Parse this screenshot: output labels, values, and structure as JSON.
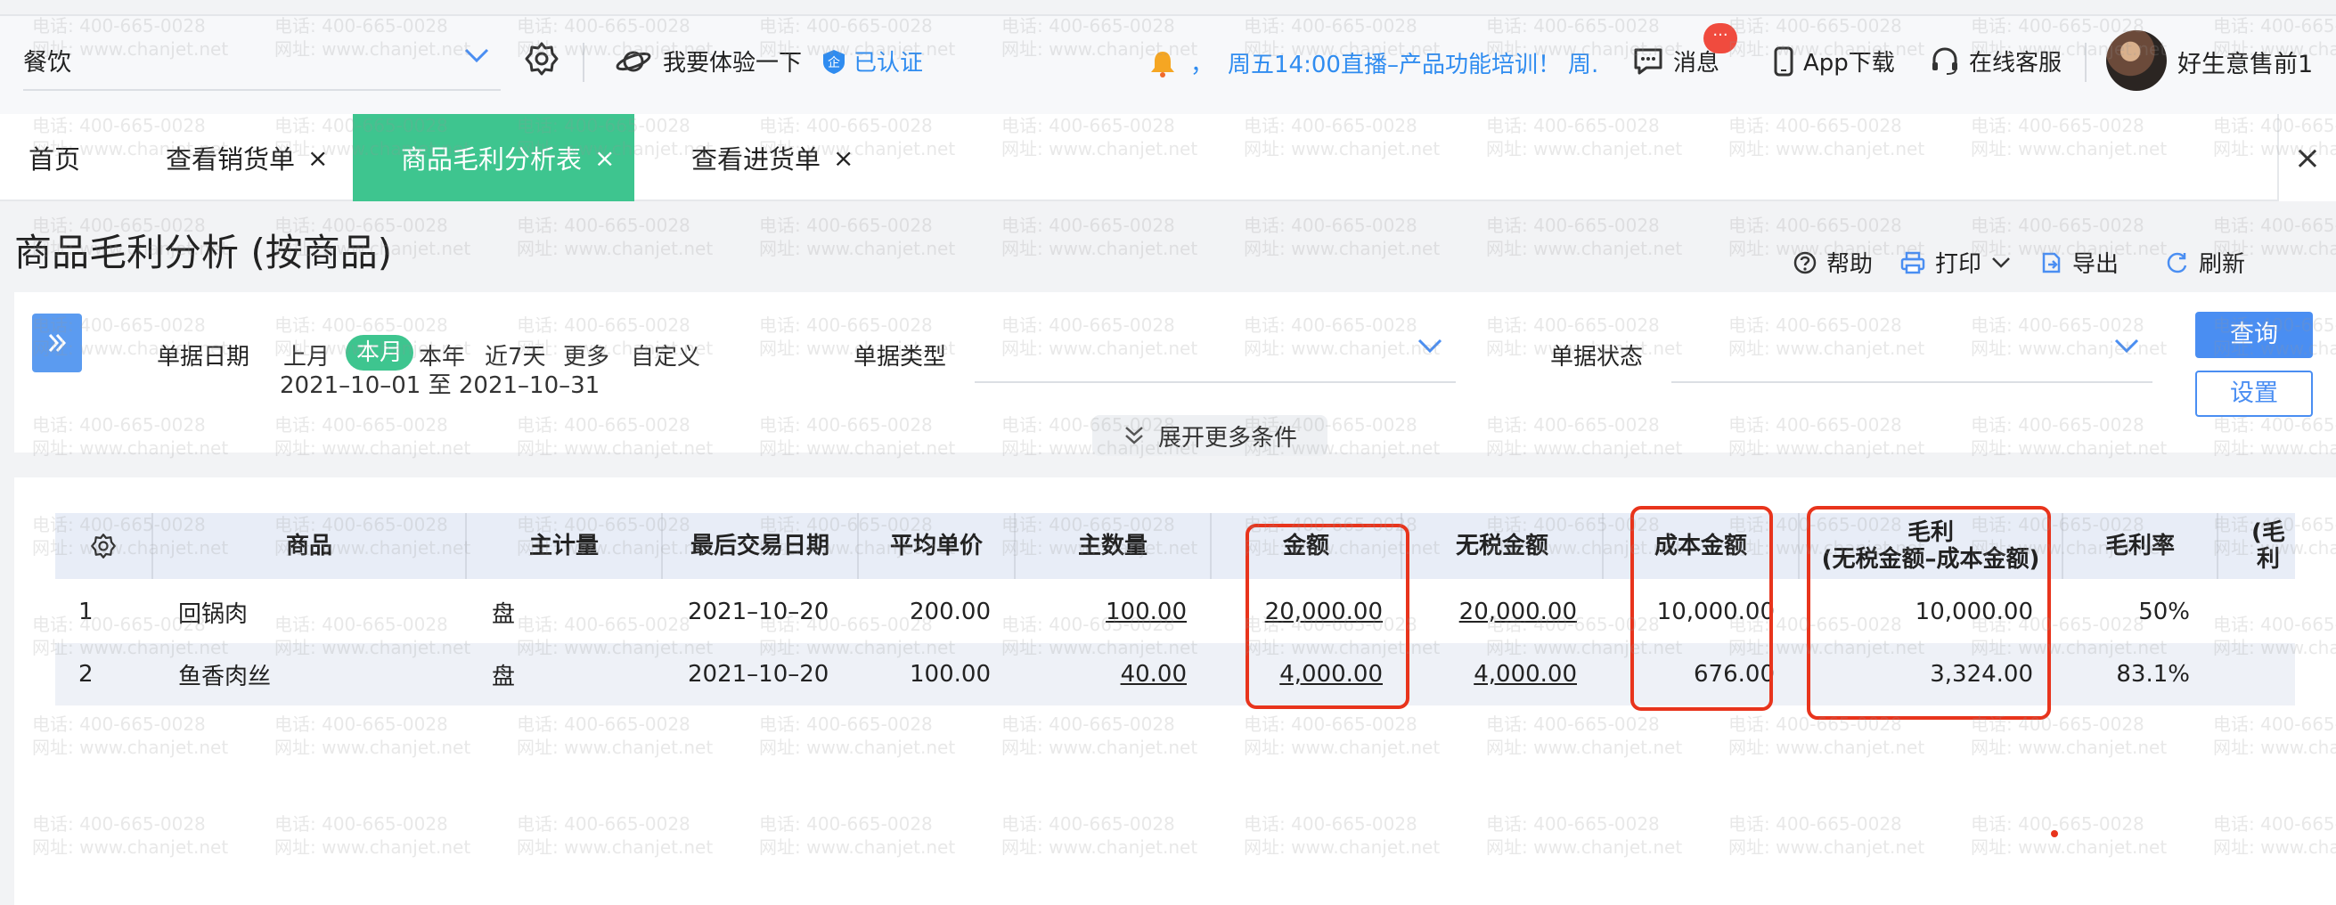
{
  "topbar": {
    "org_name": "餐饮",
    "try_label": "我要体验一下",
    "cert_label": "已认证",
    "notice_prefix": "，",
    "notice": "周五14:00直播–产品功能培训！",
    "notice_tail": "周.",
    "messages_label": "消息",
    "messages_badge": "···",
    "app_download_label": "App下载",
    "service_label": "在线客服",
    "user_name": "好生意售前1"
  },
  "tabs": [
    {
      "label": "首页",
      "closable": false,
      "active": false
    },
    {
      "label": "查看销货单",
      "closable": true,
      "active": false
    },
    {
      "label": "商品毛利分析表",
      "closable": true,
      "active": true
    },
    {
      "label": "查看进货单",
      "closable": true,
      "active": false
    }
  ],
  "tab_close_symbol": "×",
  "page_title": "商品毛利分析 (按商品)",
  "actions": {
    "help": "帮助",
    "print": "打印",
    "export": "导出",
    "refresh": "刷新"
  },
  "filters": {
    "date_label": "单据日期",
    "date_options": [
      "上月",
      "本月",
      "本年",
      "近7天",
      "更多",
      "自定义"
    ],
    "date_selected": "本月",
    "date_range": "2021–10–01 至 2021–10–31",
    "doc_type_label": "单据类型",
    "doc_status_label": "单据状态",
    "expand_label": "展开更多条件",
    "query_button": "查询",
    "setting_button": "设置"
  },
  "table": {
    "headers": [
      "商品",
      "主计量",
      "最后交易日期",
      "平均单价",
      "主数量",
      "金额",
      "无税金额",
      "成本金额",
      "毛利",
      "(无税金额–成本金额)",
      "毛利率",
      "(毛利"
    ],
    "rows": [
      {
        "index": "1",
        "product": "回锅肉",
        "unit": "盘",
        "last_date": "2021–10–20",
        "avg_price": "200.00",
        "qty": "100.00",
        "amount": "20,000.00",
        "amount_no_tax": "20,000.00",
        "cost": "10,000.00",
        "gross_profit": "10,000.00",
        "margin": "50%"
      },
      {
        "index": "2",
        "product": "鱼香肉丝",
        "unit": "盘",
        "last_date": "2021–10–20",
        "avg_price": "100.00",
        "qty": "40.00",
        "amount": "4,000.00",
        "amount_no_tax": "4,000.00",
        "cost": "676.00",
        "gross_profit": "3,324.00",
        "margin": "83.1%"
      }
    ]
  },
  "watermark": {
    "phone": "电话: 400-665-0028",
    "site": "网址: www.chanjet.net"
  },
  "colors": {
    "accent_green": "#3ec58f",
    "link_blue": "#2f8cf0",
    "primary_blue": "#4a8ef2",
    "highlight_red": "#e8341c"
  }
}
